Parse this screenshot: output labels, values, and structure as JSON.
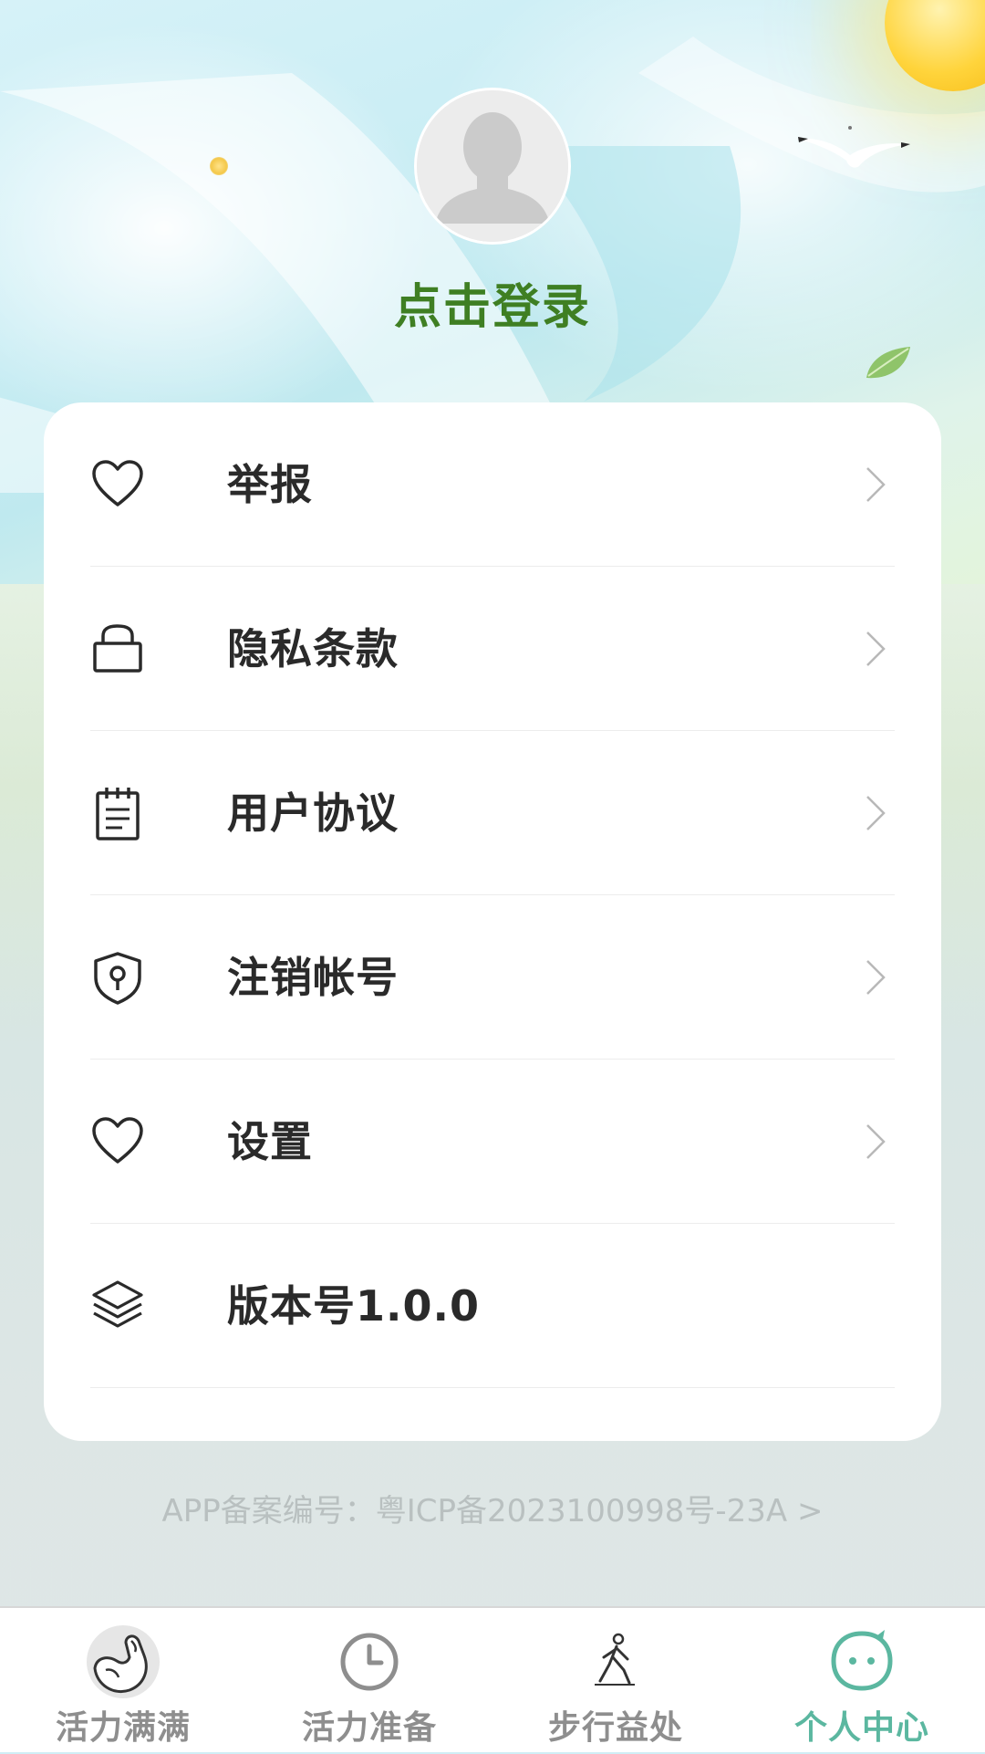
{
  "profile": {
    "login_label": "点击登录",
    "avatar_icon": "default-avatar-icon"
  },
  "menu": {
    "items": [
      {
        "label": "举报",
        "icon": "heart-icon",
        "has_chevron": true
      },
      {
        "label": "隐私条款",
        "icon": "bag-icon",
        "has_chevron": true
      },
      {
        "label": "用户协议",
        "icon": "notepad-icon",
        "has_chevron": true
      },
      {
        "label": "注销帐号",
        "icon": "shield-keyhole-icon",
        "has_chevron": true
      },
      {
        "label": "设置",
        "icon": "heart-icon",
        "has_chevron": true
      },
      {
        "label": "版本号1.0.0",
        "icon": "layers-icon",
        "has_chevron": false
      }
    ]
  },
  "footer": {
    "icp_text": "APP备案编号：粤ICP备2023100998号-23A >"
  },
  "tabbar": {
    "tabs": [
      {
        "label": "活力满满",
        "icon": "muscle-arm-icon",
        "active": false
      },
      {
        "label": "活力准备",
        "icon": "clock-icon",
        "active": false
      },
      {
        "label": "步行益处",
        "icon": "walking-person-icon",
        "active": false
      },
      {
        "label": "个人中心",
        "icon": "smiley-face-icon",
        "active": true
      }
    ]
  },
  "colors": {
    "login_green": "#3f7f23",
    "active_tab": "#5bb7a0",
    "inactive_tab": "#8e8e8e",
    "menu_text": "#2a2a2a",
    "icp_text": "#b9c0c0"
  }
}
